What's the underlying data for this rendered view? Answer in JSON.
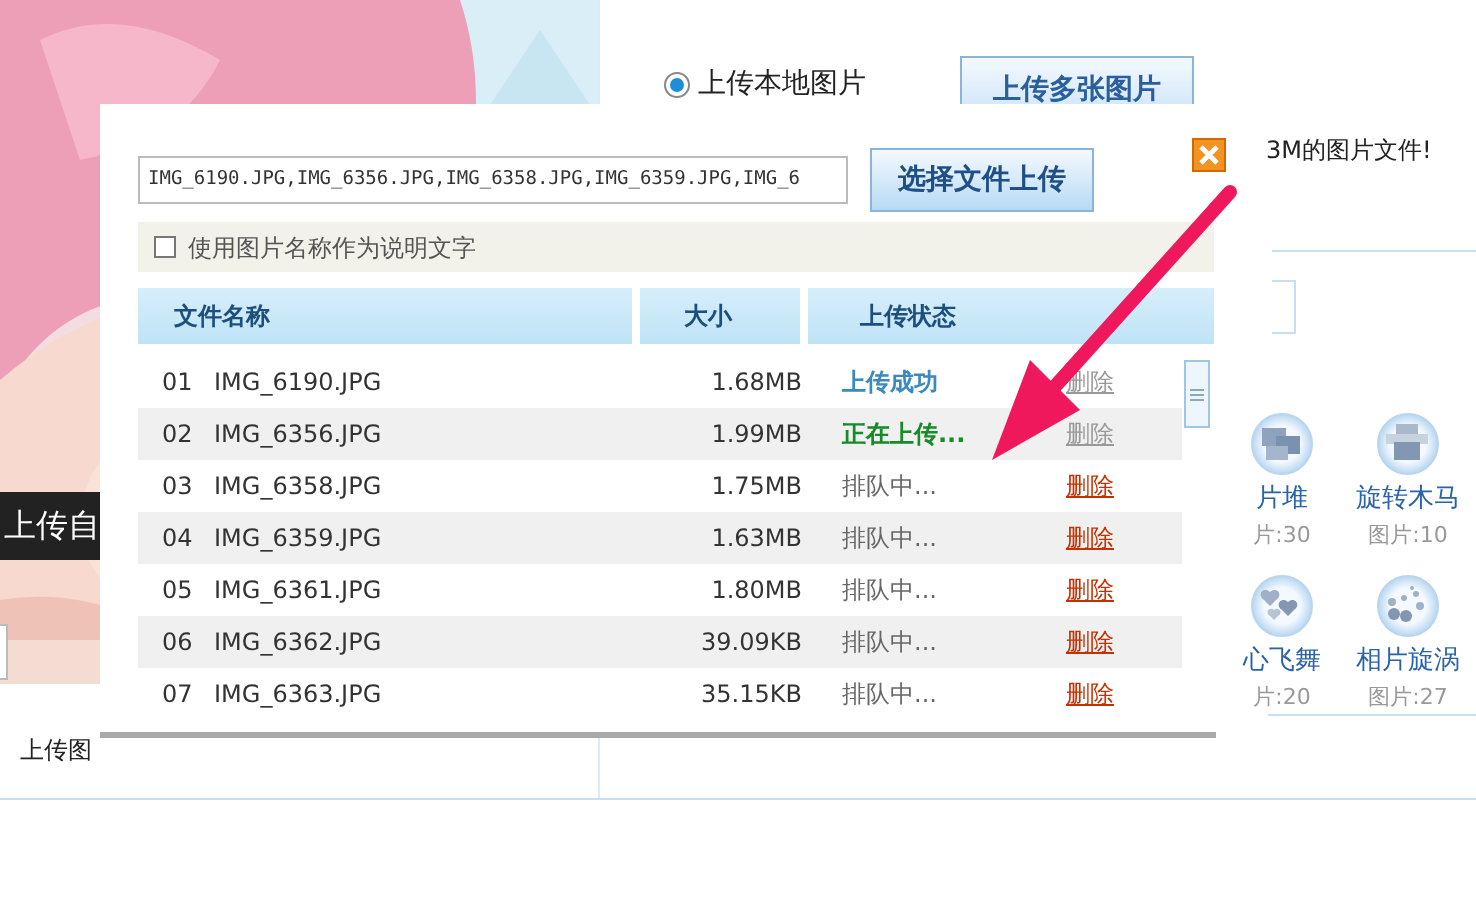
{
  "background_page": {
    "caption": "上传自",
    "upload_source": {
      "label": "上传本地图片",
      "selected": true
    },
    "multi_upload_button": "上传多张图片",
    "notice": "3M的图片文件!",
    "effects": [
      {
        "name": "片堆",
        "count": "片:30"
      },
      {
        "name": "旋转木马",
        "count": "图片:10"
      },
      {
        "name": "心飞舞",
        "count": "片:20"
      },
      {
        "name": "相片旋涡",
        "count": "图片:27"
      }
    ],
    "footer_label": "上传图"
  },
  "dialog": {
    "file_field": {
      "value": "IMG_6190.JPG,IMG_6356.JPG,IMG_6358.JPG,IMG_6359.JPG,IMG_6"
    },
    "choose_button": "选择文件上传",
    "use_name_option": {
      "label": "使用图片名称作为说明文字",
      "checked": false
    },
    "table": {
      "columns": [
        "文件名称",
        "大小",
        "上传状态"
      ],
      "rows": [
        {
          "number": "01",
          "file": "IMG_6190.JPG",
          "size": "1.68MB",
          "status": {
            "text": "上传成功",
            "kind": "done"
          },
          "delete": {
            "label": "删除",
            "disabled": true
          }
        },
        {
          "number": "02",
          "file": "IMG_6356.JPG",
          "size": "1.99MB",
          "status": {
            "text": "正在上传...",
            "kind": "uploading"
          },
          "delete": {
            "label": "删除",
            "disabled": true
          }
        },
        {
          "number": "03",
          "file": "IMG_6358.JPG",
          "size": "1.75MB",
          "status": {
            "text": "排队中...",
            "kind": "queued"
          },
          "delete": {
            "label": "删除",
            "disabled": false
          }
        },
        {
          "number": "04",
          "file": "IMG_6359.JPG",
          "size": "1.63MB",
          "status": {
            "text": "排队中...",
            "kind": "queued"
          },
          "delete": {
            "label": "删除",
            "disabled": false
          }
        },
        {
          "number": "05",
          "file": "IMG_6361.JPG",
          "size": "1.80MB",
          "status": {
            "text": "排队中...",
            "kind": "queued"
          },
          "delete": {
            "label": "删除",
            "disabled": false
          }
        },
        {
          "number": "06",
          "file": "IMG_6362.JPG",
          "size": "39.09KB",
          "status": {
            "text": "排队中...",
            "kind": "queued"
          },
          "delete": {
            "label": "删除",
            "disabled": false
          }
        },
        {
          "number": "07",
          "file": "IMG_6363.JPG",
          "size": "35.15KB",
          "status": {
            "text": "排队中...",
            "kind": "queued"
          },
          "delete": {
            "label": "删除",
            "disabled": false
          }
        }
      ]
    }
  }
}
